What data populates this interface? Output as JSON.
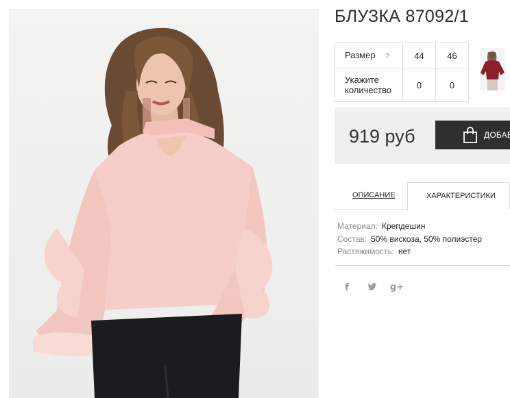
{
  "product": {
    "title": "БЛУЗКА 87092/1"
  },
  "size_table": {
    "size_label": "Размер",
    "help_icon": "?",
    "quantity_label": "Укажите количество",
    "sizes": [
      "44",
      "46"
    ],
    "quantities": [
      "0",
      "0"
    ]
  },
  "price": {
    "value": "919 руб"
  },
  "cart": {
    "button_label": "ДОБАВ",
    "icon": "shopping-bag-icon"
  },
  "tabs": {
    "description": "ОПИСАНИЕ",
    "characteristics": "ХАРАКТЕРИСТИКИ",
    "active": "characteristics"
  },
  "specs": [
    {
      "key": "Материал:",
      "value": "Крепдешин"
    },
    {
      "key": "Состав:",
      "value": "50% вискоза, 50% полиэстер"
    },
    {
      "key": "Растяжимость:",
      "value": "нет"
    }
  ],
  "social": {
    "facebook": "f",
    "google_plus": "g+"
  },
  "colors": {
    "blouse": "#f6cdc8",
    "thumbnail_blouse": "#8e1f2c",
    "price_box": "#efefef",
    "cart_button": "#2f2f2f"
  }
}
